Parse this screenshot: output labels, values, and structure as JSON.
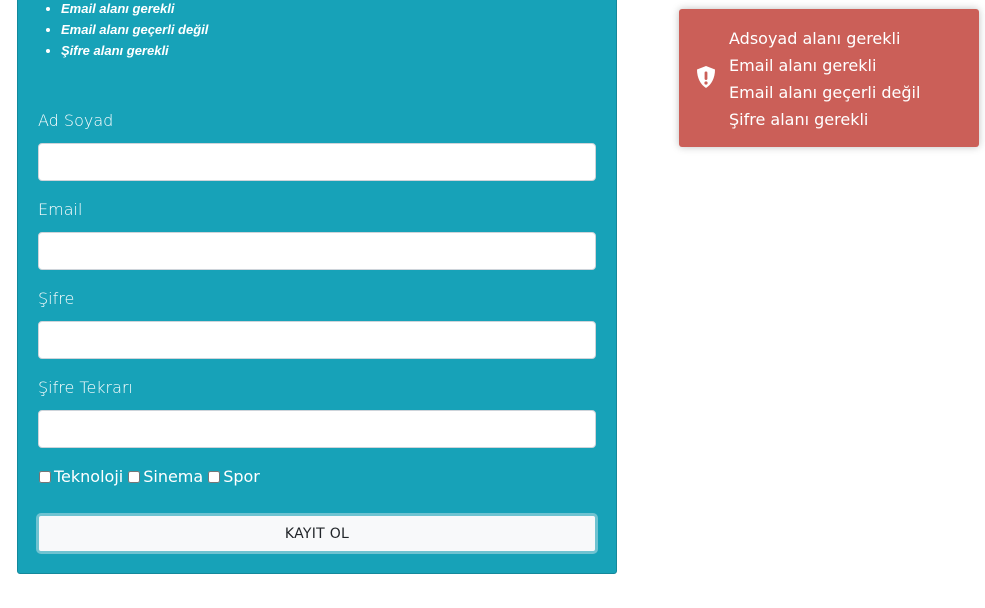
{
  "errors_summary": [
    "Email alanı gerekli",
    "Email alanı geçerli değil",
    "Şifre alanı gerekli"
  ],
  "form": {
    "name_label": "Ad Soyad",
    "email_label": "Email",
    "password_label": "Şifre",
    "password_repeat_label": "Şifre Tekrarı",
    "name_value": "",
    "email_value": "",
    "password_value": "",
    "password_repeat_value": "",
    "interests": [
      {
        "label": "Teknoloji",
        "checked": false
      },
      {
        "label": "Sinema",
        "checked": false
      },
      {
        "label": "Spor",
        "checked": false
      }
    ],
    "submit_label": "KAYIT OL"
  },
  "toast": {
    "icon": "shield-exclamation-icon",
    "messages": [
      "Adsoyad alanı gerekli",
      "Email alanı gerekli",
      "Email alanı geçerli değil",
      "Şifre alanı gerekli"
    ]
  },
  "colors": {
    "panel": "#17a2b8",
    "toast": "#cb5f58",
    "button": "#f8f9fa"
  }
}
